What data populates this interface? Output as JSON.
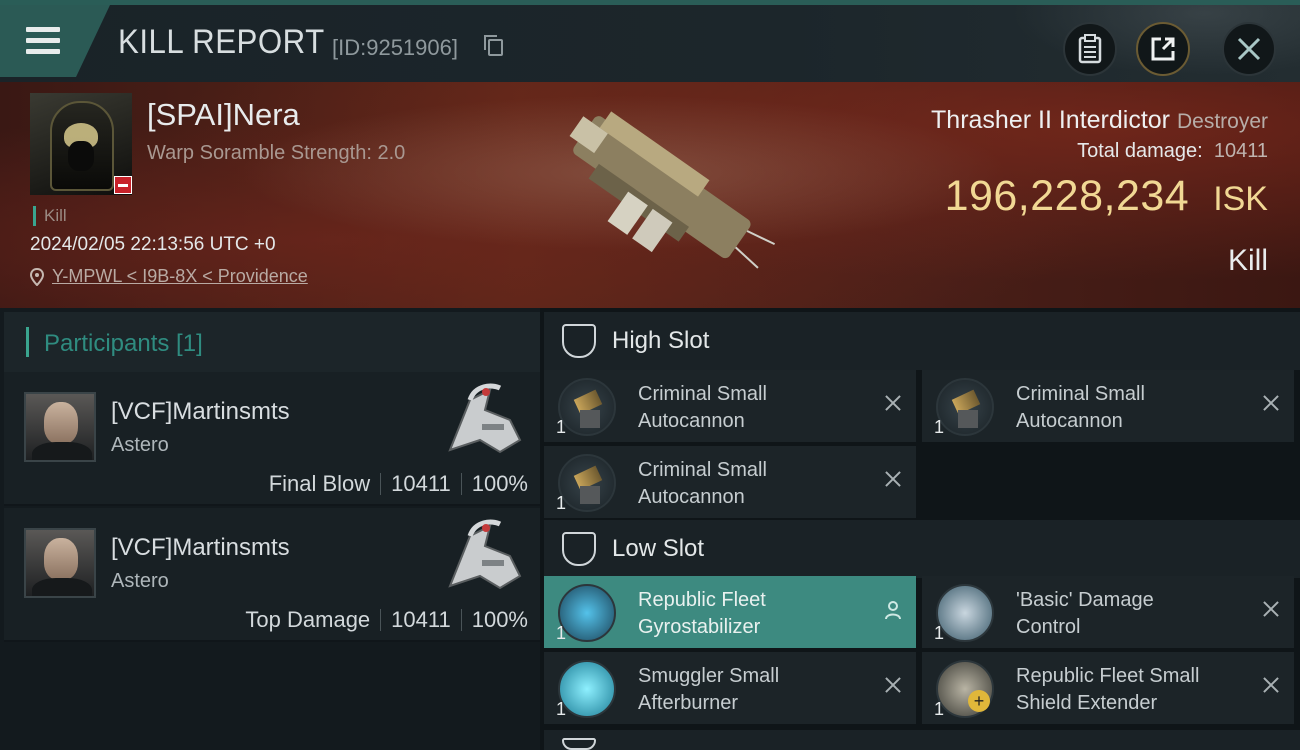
{
  "header": {
    "title": "KILL REPORT",
    "id_label": "[ID:9251906]"
  },
  "victim": {
    "name": "[SPAI]Nera",
    "subtitle": "Warp Soramble Strength: 2.0",
    "tag": "Kill",
    "time": "2024/02/05 22:13:56 UTC +0",
    "location": "Y-MPWL < I9B-8X < Providence"
  },
  "ship": {
    "name": "Thrasher II Interdictor",
    "class": "Destroyer",
    "damage_label": "Total damage:",
    "damage_value": "10411",
    "isk_value": "196,228,234",
    "isk_unit": "ISK",
    "result_label": "Kill"
  },
  "participants": {
    "title": "Participants [1]",
    "rows": [
      {
        "name": "[VCF]Martinsmts",
        "ship": "Astero",
        "role": "Final Blow",
        "damage": "10411",
        "percent": "100%"
      },
      {
        "name": "[VCF]Martinsmts",
        "ship": "Astero",
        "role": "Top Damage",
        "damage": "10411",
        "percent": "100%"
      }
    ]
  },
  "fitting": {
    "high_slot": {
      "title": "High Slot",
      "modules": [
        {
          "name": "Criminal Small\nAutocannon",
          "qty": "1"
        },
        {
          "name": "Criminal Small\nAutocannon",
          "qty": "1"
        },
        {
          "name": "Criminal Small\nAutocannon",
          "qty": "1"
        }
      ]
    },
    "low_slot": {
      "title": "Low Slot",
      "modules": [
        {
          "name": "Republic Fleet\nGyrostabilizer",
          "qty": "1"
        },
        {
          "name": "'Basic' Damage\nControl",
          "qty": "1"
        },
        {
          "name": "Smuggler Small\nAfterburner",
          "qty": "1"
        },
        {
          "name": "Republic Fleet Small\nShield Extender",
          "qty": "1"
        }
      ]
    }
  },
  "colors": {
    "accent": "#3aa58f",
    "isk_gold": "#f1d894",
    "highlight_row": "#3d8a80",
    "banner_red": "#5b2619"
  }
}
